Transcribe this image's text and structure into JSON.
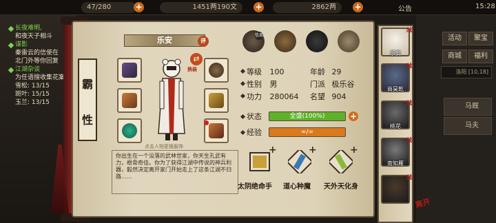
{
  "topbar": {
    "stamina": "47/280",
    "silver": "1451两190文",
    "gold": "2862两",
    "notice": "公告",
    "clock": "15:28"
  },
  "quest_panel": {
    "lines": [
      {
        "text": "长夜难明,",
        "color": "green",
        "arrow": true
      },
      {
        "text": "和夜天子相斗",
        "color": "white",
        "arrow": false
      },
      {
        "text": "谍影",
        "color": "green",
        "arrow": true
      },
      {
        "text": "秦雷云的信使在",
        "color": "white",
        "arrow": false
      },
      {
        "text": "北门外等你回复",
        "color": "white",
        "arrow": false
      },
      {
        "text": "江湖杂谈",
        "color": "green",
        "arrow": true
      },
      {
        "text": "为任语搜收集花案",
        "color": "white",
        "arrow": false
      },
      {
        "text": "雪松: 13/15",
        "color": "white",
        "arrow": false
      },
      {
        "text": "斑叶: 15/15",
        "color": "white",
        "arrow": false
      },
      {
        "text": "玉兰: 13/15",
        "color": "white",
        "arrow": false
      }
    ]
  },
  "right_menu": {
    "buttons": [
      "活动",
      "聚宝",
      "商城",
      "福利"
    ],
    "field": "洛阳 [10,18]",
    "list": [
      "马厩",
      "马夫"
    ]
  },
  "scroll_title": [
    "霸",
    "性"
  ],
  "character": {
    "name": "乐安",
    "eval_label": "评",
    "swap_label": "换装",
    "hint": "点击人物更换服饰",
    "bio": "你出生在一个没落的武林世家，你天生孔武有力，根骨奇佳。你为了获得江湖中传说的神兵利器，毅然决定离开家门开始走上了这条江湖不归路……"
  },
  "stats": {
    "level_label": "等级",
    "level": "100",
    "age_label": "年龄",
    "age": "29",
    "gender_label": "性别",
    "gender": "男",
    "sect_label": "门派",
    "sect": "极乐谷",
    "power_label": "功力",
    "power": "280064",
    "fame_label": "名望",
    "fame": "904",
    "state_label": "状态",
    "state_text": "全盛(100%)",
    "state_fill": 1.0,
    "exp_label": "经验",
    "exp_text": "∞/∞",
    "exp_fill": 1.0
  },
  "feature_badge": "信息",
  "skills": [
    {
      "name": "太阴绝命手",
      "icon": "scroll-skill-icon"
    },
    {
      "name": "道心种魔",
      "icon": "cylinder-scroll-icon"
    },
    {
      "name": "天外天化身",
      "icon": "bamboo-scroll-icon"
    }
  ],
  "roster": [
    {
      "name": "乐安",
      "battle": "战"
    },
    {
      "name": "商昊乾",
      "battle": "战"
    },
    {
      "name": "桃花",
      "battle": "战"
    },
    {
      "name": "南知雁",
      "battle": "战"
    },
    {
      "name": "",
      "battle": "战"
    }
  ],
  "seal_text": "离开",
  "colors": {
    "state_bar": "#5fb12a",
    "exp_bar": "#d97a1c",
    "accent": "#b8481c"
  }
}
